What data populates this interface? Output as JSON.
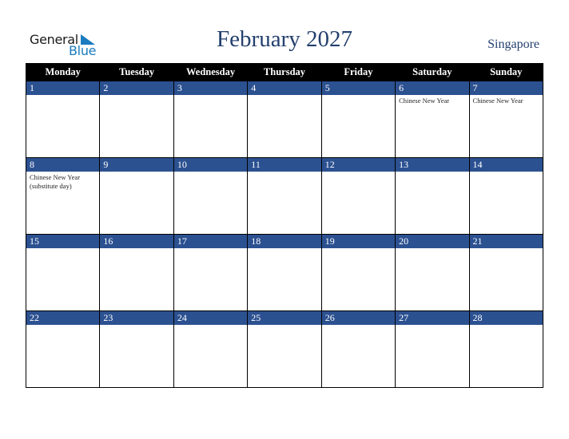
{
  "logo": {
    "word1": "General",
    "word2": "Blue"
  },
  "header": {
    "title": "February 2027",
    "country": "Singapore"
  },
  "colors": {
    "title": "#24406e",
    "day_band": "#2c5191",
    "header_bg": "#000000",
    "logo_blue": "#1a7bbf"
  },
  "weekdays": [
    "Monday",
    "Tuesday",
    "Wednesday",
    "Thursday",
    "Friday",
    "Saturday",
    "Sunday"
  ],
  "weeks": [
    [
      {
        "day": "1",
        "event": ""
      },
      {
        "day": "2",
        "event": ""
      },
      {
        "day": "3",
        "event": ""
      },
      {
        "day": "4",
        "event": ""
      },
      {
        "day": "5",
        "event": ""
      },
      {
        "day": "6",
        "event": "Chinese New Year"
      },
      {
        "day": "7",
        "event": "Chinese New Year"
      }
    ],
    [
      {
        "day": "8",
        "event": "Chinese New Year (substitute day)"
      },
      {
        "day": "9",
        "event": ""
      },
      {
        "day": "10",
        "event": ""
      },
      {
        "day": "11",
        "event": ""
      },
      {
        "day": "12",
        "event": ""
      },
      {
        "day": "13",
        "event": ""
      },
      {
        "day": "14",
        "event": ""
      }
    ],
    [
      {
        "day": "15",
        "event": ""
      },
      {
        "day": "16",
        "event": ""
      },
      {
        "day": "17",
        "event": ""
      },
      {
        "day": "18",
        "event": ""
      },
      {
        "day": "19",
        "event": ""
      },
      {
        "day": "20",
        "event": ""
      },
      {
        "day": "21",
        "event": ""
      }
    ],
    [
      {
        "day": "22",
        "event": ""
      },
      {
        "day": "23",
        "event": ""
      },
      {
        "day": "24",
        "event": ""
      },
      {
        "day": "25",
        "event": ""
      },
      {
        "day": "26",
        "event": ""
      },
      {
        "day": "27",
        "event": ""
      },
      {
        "day": "28",
        "event": ""
      }
    ]
  ]
}
